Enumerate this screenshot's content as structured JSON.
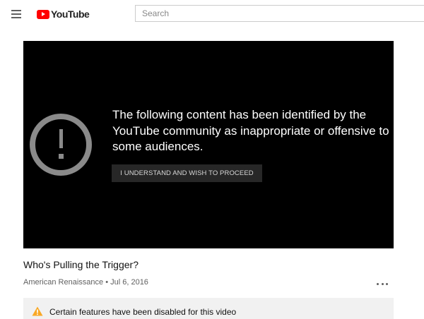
{
  "header": {
    "logo_text": "YouTube",
    "search_placeholder": "Search"
  },
  "player": {
    "warning_message": "The following content has been identified by the YouTube community as inappropriate or offensive to some audiences.",
    "proceed_label": "I UNDERSTAND AND WISH TO PROCEED"
  },
  "video": {
    "title": "Who's Pulling the Trigger?",
    "channel": "American Renaissance",
    "separator": "•",
    "date": "Jul 6, 2016"
  },
  "notice": {
    "text": "Certain features have been disabled for this video"
  },
  "colors": {
    "brand_red": "#ff0000",
    "warning_yellow": "#f9a825",
    "player_background": "#000000"
  },
  "icons": {
    "menu": "hamburger-menu-icon",
    "logo": "youtube-play-icon",
    "warning": "exclamation-circle-icon",
    "more": "more-horizontal-icon",
    "notice": "warning-triangle-icon"
  }
}
